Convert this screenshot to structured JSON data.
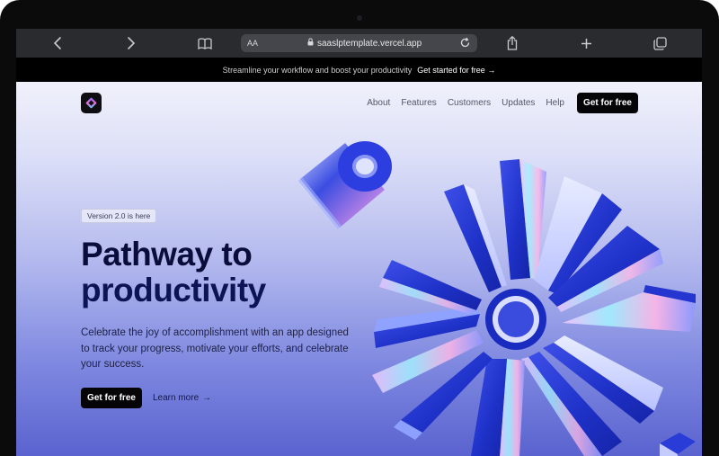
{
  "browser": {
    "text_size_label": "AA",
    "url": "saaslptemplate.vercel.app",
    "icons": [
      "chevron-left-icon",
      "chevron-right-icon",
      "book-icon",
      "lock-icon",
      "reload-icon",
      "share-icon",
      "plus-icon",
      "tabs-icon"
    ]
  },
  "announcement": {
    "text": "Streamline your workflow and boost your productivity",
    "cta_label": "Get started for free",
    "cta_arrow": "→"
  },
  "nav": {
    "links": [
      "About",
      "Features",
      "Customers",
      "Updates",
      "Help"
    ],
    "cta_label": "Get for free"
  },
  "hero": {
    "badge": "Version 2.0 is here",
    "headline_line1": "Pathway to",
    "headline_line2": "productivity",
    "subtext": "Celebrate the joy of accomplishment with an app designed to track your progress, motivate your efforts, and celebrate your success.",
    "primary_cta": "Get for free",
    "secondary_cta": "Learn more",
    "secondary_arrow": "→"
  },
  "colors": {
    "accent": "#2b3fd6",
    "button": "#050507",
    "headline": "#0a0c3a"
  }
}
